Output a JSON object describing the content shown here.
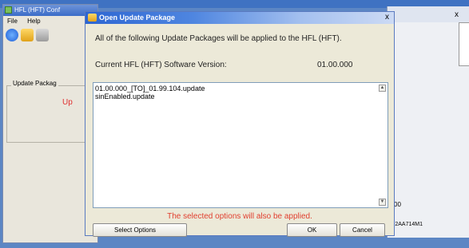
{
  "background_app": {
    "title": "HFL (HFT) Conf",
    "menu": [
      "File",
      "Help"
    ],
    "group_label": "Update Packag",
    "red_text": "Up"
  },
  "right_window": {
    "close": "x",
    "value1": "00",
    "value2": "'2AA714M1"
  },
  "dialog": {
    "title": "Open Update Package",
    "close": "x",
    "message": "All of the following Update Packages will be applied to the HFL (HFT).",
    "version_label": "Current HFL (HFT) Software Version:",
    "version_value": "01.00.000",
    "packages": [
      "01.00.000_[TO]_01.99.104.update",
      "sinEnabled.update"
    ],
    "note": "The selected options will also be applied.",
    "buttons": {
      "select_options": "Select Options",
      "ok": "OK",
      "cancel": "Cancel"
    }
  }
}
